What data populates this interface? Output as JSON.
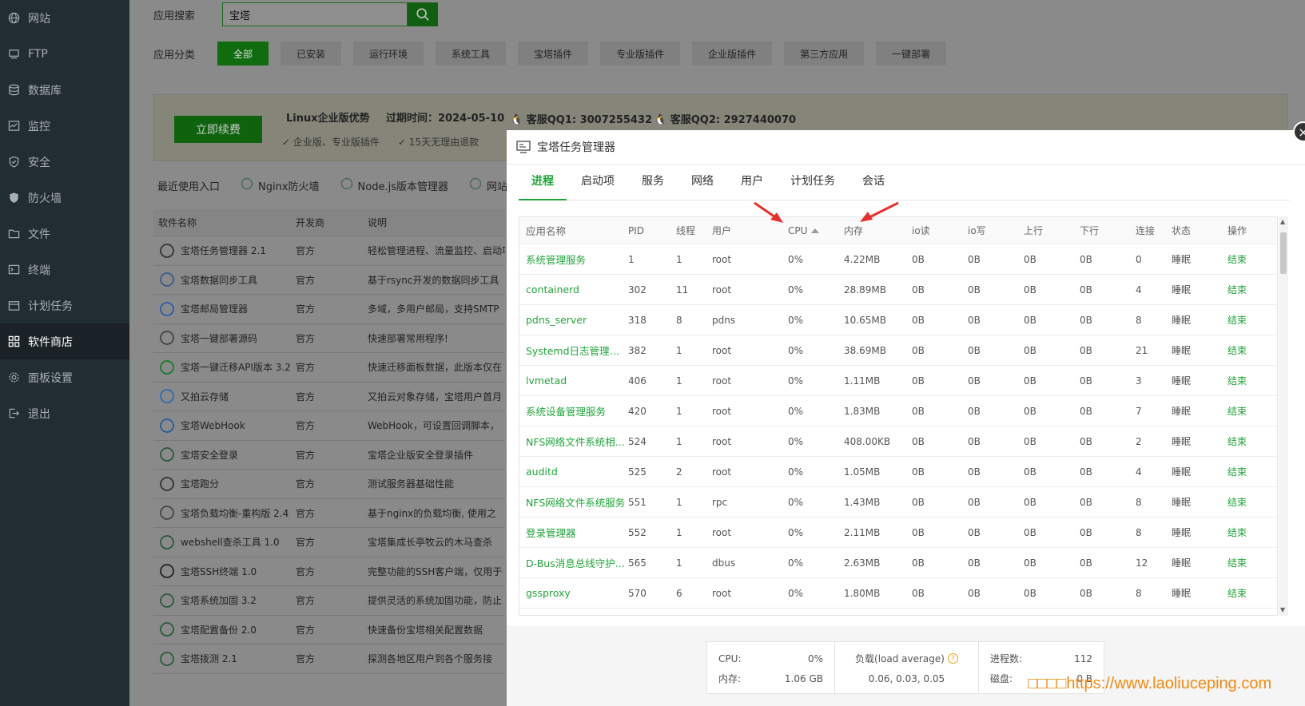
{
  "sidebar": {
    "items": [
      {
        "label": "网站",
        "icon": "globe-icon"
      },
      {
        "label": "FTP",
        "icon": "ftp-icon"
      },
      {
        "label": "数据库",
        "icon": "database-icon"
      },
      {
        "label": "监控",
        "icon": "monitor-icon"
      },
      {
        "label": "安全",
        "icon": "shield-icon"
      },
      {
        "label": "防火墙",
        "icon": "firewall-icon"
      },
      {
        "label": "文件",
        "icon": "folder-icon"
      },
      {
        "label": "终端",
        "icon": "terminal-icon"
      },
      {
        "label": "计划任务",
        "icon": "calendar-icon"
      },
      {
        "label": "软件商店",
        "icon": "grid-icon"
      },
      {
        "label": "面板设置",
        "icon": "gear-icon"
      },
      {
        "label": "退出",
        "icon": "logout-icon"
      }
    ],
    "active_index": 9
  },
  "search": {
    "label": "应用搜索",
    "value": "宝塔"
  },
  "categories": {
    "label": "应用分类",
    "items": [
      "全部",
      "已安装",
      "运行环境",
      "系统工具",
      "宝塔插件",
      "专业版插件",
      "企业版插件",
      "第三方应用",
      "一键部署"
    ]
  },
  "promo": {
    "renew": "立即续费",
    "title": "Linux企业版优势",
    "expire": "过期时间：2024-05-10",
    "feature1": "企业版、专业版插件",
    "feature2": "15天无理由退款",
    "qq1": "客服QQ1: 3007255432",
    "qq2": "客服QQ2: 2927440070"
  },
  "recent": {
    "label": "最近使用入口",
    "items": [
      "Nginx防火墙",
      "Node.js版本管理器",
      "网站"
    ]
  },
  "bg_table": {
    "headers": [
      "软件名称",
      "开发商",
      "说明"
    ],
    "rows": [
      {
        "name": "宝塔任务管理器 2.1",
        "dev": "官方",
        "desc": "轻松管理进程、流量监控、启动项"
      },
      {
        "name": "宝塔数据同步工具",
        "dev": "官方",
        "desc": "基于rsync开发的数据同步工具"
      },
      {
        "name": "宝塔邮局管理器",
        "dev": "官方",
        "desc": "多域，多用户邮局，支持SMTP"
      },
      {
        "name": "宝塔一键部署源码",
        "dev": "官方",
        "desc": "快速部署常用程序!"
      },
      {
        "name": "宝塔一键迁移API版本 3.2",
        "dev": "官方",
        "desc": "快速迁移面板数据，此版本仅在"
      },
      {
        "name": "又拍云存储",
        "dev": "官方",
        "desc": "又拍云对象存储，宝塔用户首月"
      },
      {
        "name": "宝塔WebHook",
        "dev": "官方",
        "desc": "WebHook，可设置回调脚本，"
      },
      {
        "name": "宝塔安全登录",
        "dev": "官方",
        "desc": "宝塔企业版安全登录插件"
      },
      {
        "name": "宝塔跑分",
        "dev": "官方",
        "desc": "测试服务器基础性能"
      },
      {
        "name": "宝塔负载均衡-重构版 2.4",
        "dev": "官方",
        "desc": "基于nginx的负载均衡, 使用之"
      },
      {
        "name": "webshell查杀工具 1.0",
        "dev": "官方",
        "desc": "宝塔集成长亭牧云的木马查杀"
      },
      {
        "name": "宝塔SSH终端 1.0",
        "dev": "官方",
        "desc": "完整功能的SSH客户端，仅用于"
      },
      {
        "name": "宝塔系统加固 3.2",
        "dev": "官方",
        "desc": "提供灵活的系统加固功能，防止"
      },
      {
        "name": "宝塔配置备份 2.0",
        "dev": "官方",
        "desc": "快速备份宝塔相关配置数据"
      },
      {
        "name": "宝塔拨测 2.1",
        "dev": "官方",
        "desc": "探测各地区用户到各个服务接"
      }
    ]
  },
  "modal": {
    "title": "宝塔任务管理器",
    "close": "×",
    "tabs": [
      "进程",
      "启动项",
      "服务",
      "网络",
      "用户",
      "计划任务",
      "会话"
    ],
    "headers": [
      "应用名称",
      "PID",
      "线程",
      "用户",
      "CPU",
      "内存",
      "io读",
      "io写",
      "上行",
      "下行",
      "连接",
      "状态",
      "操作"
    ],
    "rows": [
      [
        "系统管理服务",
        "1",
        "1",
        "root",
        "0%",
        "4.22MB",
        "0B",
        "0B",
        "0B",
        "0B",
        "0",
        "睡眠",
        "结束"
      ],
      [
        "containerd",
        "302",
        "11",
        "root",
        "0%",
        "28.89MB",
        "0B",
        "0B",
        "0B",
        "0B",
        "4",
        "睡眠",
        "结束"
      ],
      [
        "pdns_server",
        "318",
        "8",
        "pdns",
        "0%",
        "10.65MB",
        "0B",
        "0B",
        "0B",
        "0B",
        "8",
        "睡眠",
        "结束"
      ],
      [
        "Systemd日志管理服...",
        "382",
        "1",
        "root",
        "0%",
        "38.69MB",
        "0B",
        "0B",
        "0B",
        "0B",
        "21",
        "睡眠",
        "结束"
      ],
      [
        "lvmetad",
        "406",
        "1",
        "root",
        "0%",
        "1.11MB",
        "0B",
        "0B",
        "0B",
        "0B",
        "3",
        "睡眠",
        "结束"
      ],
      [
        "系统设备管理服务",
        "420",
        "1",
        "root",
        "0%",
        "1.83MB",
        "0B",
        "0B",
        "0B",
        "0B",
        "7",
        "睡眠",
        "结束"
      ],
      [
        "NFS网络文件系统相...",
        "524",
        "1",
        "root",
        "0%",
        "408.00KB",
        "0B",
        "0B",
        "0B",
        "0B",
        "2",
        "睡眠",
        "结束"
      ],
      [
        "auditd",
        "525",
        "2",
        "root",
        "0%",
        "1.05MB",
        "0B",
        "0B",
        "0B",
        "0B",
        "4",
        "睡眠",
        "结束"
      ],
      [
        "NFS网络文件系统服务",
        "551",
        "1",
        "rpc",
        "0%",
        "1.43MB",
        "0B",
        "0B",
        "0B",
        "0B",
        "8",
        "睡眠",
        "结束"
      ],
      [
        "登录管理器",
        "552",
        "1",
        "root",
        "0%",
        "2.11MB",
        "0B",
        "0B",
        "0B",
        "0B",
        "8",
        "睡眠",
        "结束"
      ],
      [
        "D-Bus消息总线守护...",
        "565",
        "1",
        "dbus",
        "0%",
        "2.63MB",
        "0B",
        "0B",
        "0B",
        "0B",
        "12",
        "睡眠",
        "结束"
      ],
      [
        "gssproxy",
        "570",
        "6",
        "root",
        "0%",
        "1.80MB",
        "0B",
        "0B",
        "0B",
        "0B",
        "8",
        "睡眠",
        "结束"
      ]
    ],
    "stats": {
      "cpu_label": "CPU:",
      "cpu_value": "0%",
      "mem_label": "内存:",
      "mem_value": "1.06 GB",
      "load_label": "负载(load average)",
      "load_value": "0.06, 0.03, 0.05",
      "proc_label": "进程数:",
      "proc_value": "112",
      "disk_label": "磁盘:",
      "disk_value": "0 B"
    }
  },
  "watermark": "□□□□https://www.laoliuceping.com",
  "colors": {
    "accent": "#20a53a",
    "sidebar": "#222c33",
    "arrow": "#e8302a"
  }
}
